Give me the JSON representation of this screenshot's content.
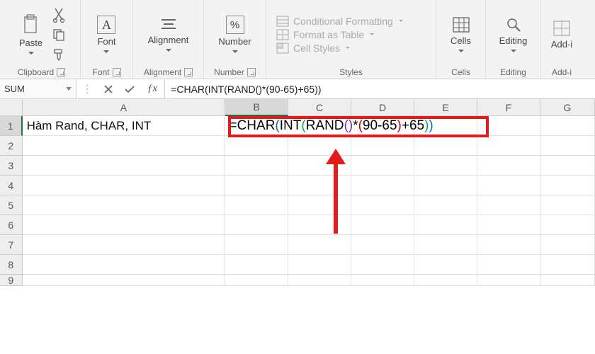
{
  "ribbon": {
    "clipboard": {
      "paste": "Paste",
      "label": "Clipboard"
    },
    "font": {
      "btn": "Font",
      "letter": "A",
      "label": "Font"
    },
    "alignment": {
      "btn": "Alignment",
      "label": "Alignment"
    },
    "number": {
      "btn": "Number",
      "pct": "%",
      "label": "Number"
    },
    "styles": {
      "cond": "Conditional Formatting",
      "table": "Format as Table",
      "cell": "Cell Styles",
      "label": "Styles"
    },
    "cells": {
      "btn": "Cells",
      "label": "Cells"
    },
    "editing": {
      "btn": "Editing",
      "label": "Editing"
    },
    "addins": {
      "btn": "Add-i",
      "label": "Add-i"
    }
  },
  "namebox": "SUM",
  "formula_bar": "=CHAR(INT(RAND()*(90-65)+65))",
  "columns": [
    "A",
    "B",
    "C",
    "D",
    "E",
    "F",
    "G"
  ],
  "rows": [
    "1",
    "2",
    "3",
    "4",
    "5",
    "6",
    "7",
    "8",
    "9"
  ],
  "cell_A1": "Hàm Rand, CHAR, INT",
  "formula_tokens": [
    {
      "t": "=CHAR",
      "c": "k-black"
    },
    {
      "t": "(",
      "c": "k-blue"
    },
    {
      "t": "INT",
      "c": "k-black"
    },
    {
      "t": "(",
      "c": "k-green"
    },
    {
      "t": "RAND",
      "c": "k-black"
    },
    {
      "t": "()",
      "c": "k-purple"
    },
    {
      "t": "*",
      "c": "k-black"
    },
    {
      "t": "(",
      "c": "k-red"
    },
    {
      "t": "90-65",
      "c": "k-black"
    },
    {
      "t": ")",
      "c": "k-red"
    },
    {
      "t": "+65",
      "c": "k-black"
    },
    {
      "t": ")",
      "c": "k-green"
    },
    {
      "t": ")",
      "c": "k-blue"
    }
  ],
  "active_cell": "B1"
}
